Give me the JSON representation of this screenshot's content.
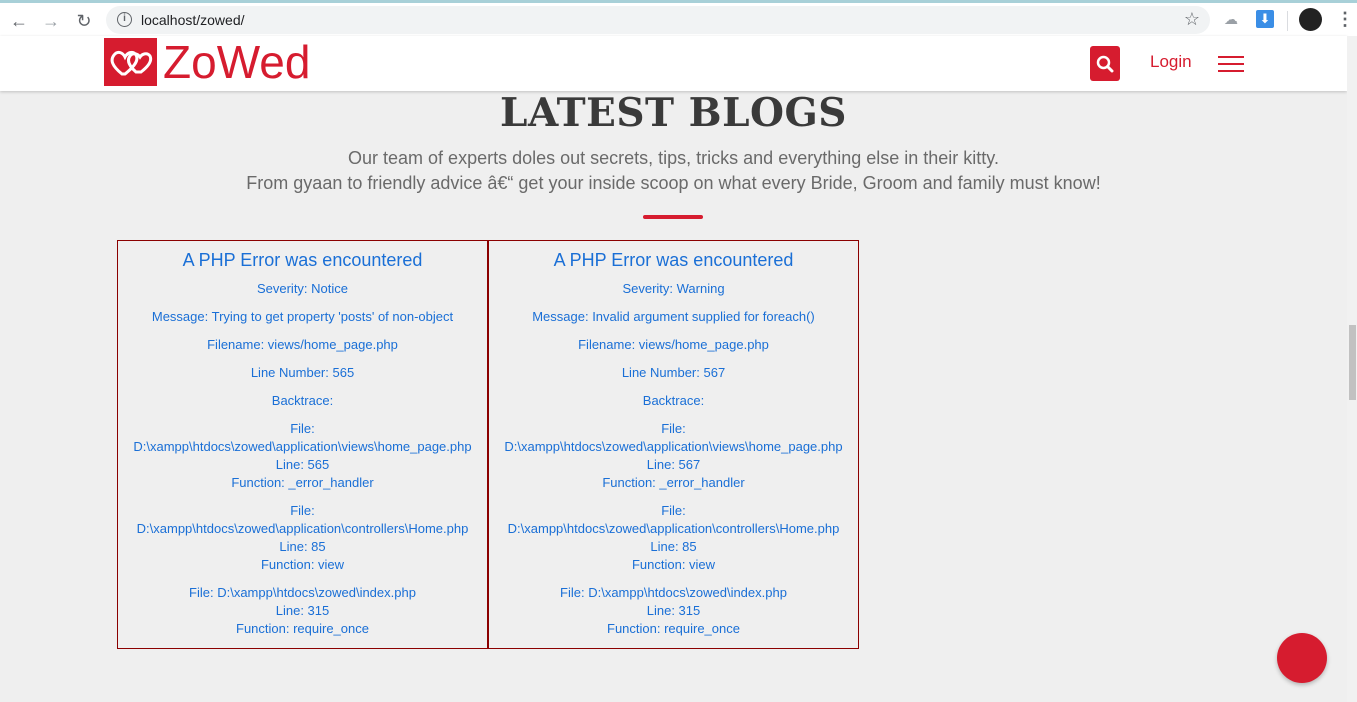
{
  "browser": {
    "url": "localhost/zowed/"
  },
  "header": {
    "logo_text_1": "Zo",
    "logo_text_2": "Wed",
    "login_label": "Login"
  },
  "blogs": {
    "title": "LATEST BLOGS",
    "subtitle_1": "Our team of experts doles out secrets, tips, tricks and everything else in their kitty.",
    "subtitle_2": "From gyaan to friendly advice â€“ get your inside scoop on what every Bride, Groom and family must know!"
  },
  "errors": [
    {
      "title": "A PHP Error was encountered",
      "severity": "Severity: Notice",
      "message": "Message: Trying to get property 'posts' of non-object",
      "filename": "Filename: views/home_page.php",
      "line_number": "Line Number: 565",
      "backtrace_label": "Backtrace:",
      "traces": [
        {
          "file_label": "File:",
          "file": "D:\\xampp\\htdocs\\zowed\\application\\views\\home_page.php",
          "line": "Line: 565",
          "function": "Function: _error_handler"
        },
        {
          "file_label": "File:",
          "file": "D:\\xampp\\htdocs\\zowed\\application\\controllers\\Home.php",
          "line": "Line: 85",
          "function": "Function: view"
        },
        {
          "file_full": "File: D:\\xampp\\htdocs\\zowed\\index.php",
          "line": "Line: 315",
          "function": "Function: require_once"
        }
      ]
    },
    {
      "title": "A PHP Error was encountered",
      "severity": "Severity: Warning",
      "message": "Message: Invalid argument supplied for foreach()",
      "filename": "Filename: views/home_page.php",
      "line_number": "Line Number: 567",
      "backtrace_label": "Backtrace:",
      "traces": [
        {
          "file_label": "File:",
          "file": "D:\\xampp\\htdocs\\zowed\\application\\views\\home_page.php",
          "line": "Line: 567",
          "function": "Function: _error_handler"
        },
        {
          "file_label": "File:",
          "file": "D:\\xampp\\htdocs\\zowed\\application\\controllers\\Home.php",
          "line": "Line: 85",
          "function": "Function: view"
        },
        {
          "file_full": "File: D:\\xampp\\htdocs\\zowed\\index.php",
          "line": "Line: 315",
          "function": "Function: require_once"
        }
      ]
    }
  ],
  "colors": {
    "brand": "#d61c2f",
    "error_text": "#1a6fd6",
    "error_border": "#8b0000"
  }
}
